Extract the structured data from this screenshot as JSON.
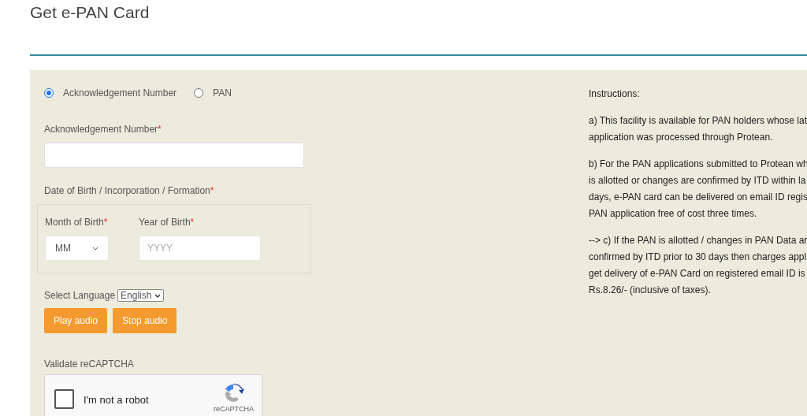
{
  "title": "Get e-PAN Card",
  "search_by": [
    {
      "label": "Acknowledgement Number",
      "selected": true
    },
    {
      "label": "PAN",
      "selected": false
    }
  ],
  "ack_field": {
    "label": "Acknowledgement Number",
    "required_mark": "*"
  },
  "dob": {
    "label": "Date of Birth / Incorporation / Formation",
    "required_mark": "*",
    "month": {
      "label": "Month of Birth",
      "required_mark": "*",
      "value": "MM"
    },
    "year": {
      "label": "Year of Birth",
      "required_mark": "*",
      "placeholder": "YYYY"
    }
  },
  "language": {
    "label": "Select Language",
    "value": "English"
  },
  "buttons": [
    "Play audio",
    "Stop audio"
  ],
  "captcha": {
    "label": "Validate reCAPTCHA",
    "checkbox_label": "I'm not a robot",
    "checked": false,
    "brand": "reCAPTCHA"
  },
  "instructions": {
    "heading": "Instructions:",
    "paragraphs": [
      [
        "a) This facility is available for PAN holders whose lat",
        "application was processed through Protean."
      ],
      [
        "b) For the PAN applications submitted to Protean wh",
        "is allotted or changes are confirmed by ITD within la",
        "days, e-PAN card can be delivered on email ID regis",
        "PAN application free of cost three times."
      ],
      [
        "--> c) If the PAN is allotted / changes in PAN Data ar",
        "confirmed by ITD prior to 30 days then charges appl",
        "get delivery of e-PAN Card on registered email ID is",
        "Rs.8.26/- (inclusive of taxes)."
      ]
    ]
  }
}
